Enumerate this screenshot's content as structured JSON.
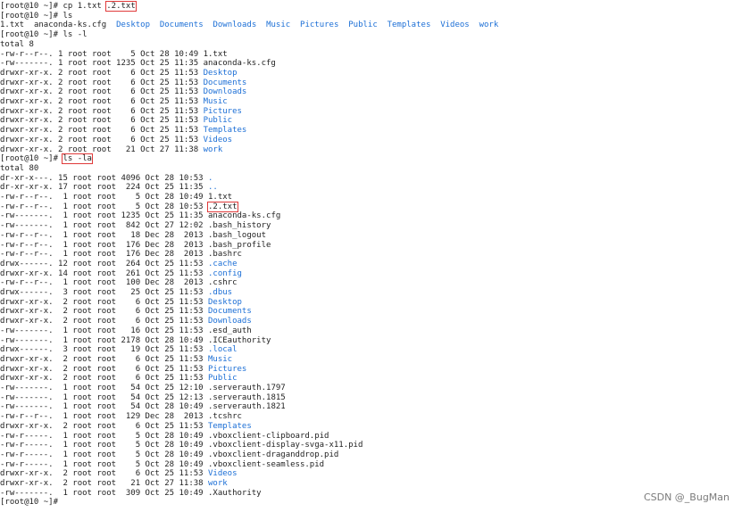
{
  "terminal": {
    "prompt": "[root@10 ~]# ",
    "lines": [
      {
        "kind": "cmd",
        "text": "cp 1.txt ",
        "hl": ".2.txt"
      },
      {
        "kind": "cmd",
        "text": "ls"
      },
      {
        "kind": "ls",
        "items": [
          {
            "t": "1.txt",
            "d": false
          },
          {
            "t": "anaconda-ks.cfg",
            "d": false
          },
          {
            "t": "Desktop",
            "d": true
          },
          {
            "t": "Documents",
            "d": true
          },
          {
            "t": "Downloads",
            "d": true
          },
          {
            "t": "Music",
            "d": true
          },
          {
            "t": "Pictures",
            "d": true
          },
          {
            "t": "Public",
            "d": true
          },
          {
            "t": "Templates",
            "d": true
          },
          {
            "t": "Videos",
            "d": true
          },
          {
            "t": "work",
            "d": true
          }
        ]
      },
      {
        "kind": "cmd",
        "text": "ls -l"
      },
      {
        "kind": "plain",
        "text": "total 8"
      },
      {
        "kind": "row",
        "p": "-rw-r--r--. 1 root root    5 Oct 28 10:49 ",
        "n": "1.txt",
        "d": false
      },
      {
        "kind": "row",
        "p": "-rw-------. 1 root root 1235 Oct 25 11:35 ",
        "n": "anaconda-ks.cfg",
        "d": false
      },
      {
        "kind": "row",
        "p": "drwxr-xr-x. 2 root root    6 Oct 25 11:53 ",
        "n": "Desktop",
        "d": true
      },
      {
        "kind": "row",
        "p": "drwxr-xr-x. 2 root root    6 Oct 25 11:53 ",
        "n": "Documents",
        "d": true
      },
      {
        "kind": "row",
        "p": "drwxr-xr-x. 2 root root    6 Oct 25 11:53 ",
        "n": "Downloads",
        "d": true
      },
      {
        "kind": "row",
        "p": "drwxr-xr-x. 2 root root    6 Oct 25 11:53 ",
        "n": "Music",
        "d": true
      },
      {
        "kind": "row",
        "p": "drwxr-xr-x. 2 root root    6 Oct 25 11:53 ",
        "n": "Pictures",
        "d": true
      },
      {
        "kind": "row",
        "p": "drwxr-xr-x. 2 root root    6 Oct 25 11:53 ",
        "n": "Public",
        "d": true
      },
      {
        "kind": "row",
        "p": "drwxr-xr-x. 2 root root    6 Oct 25 11:53 ",
        "n": "Templates",
        "d": true
      },
      {
        "kind": "row",
        "p": "drwxr-xr-x. 2 root root    6 Oct 25 11:53 ",
        "n": "Videos",
        "d": true
      },
      {
        "kind": "row",
        "p": "drwxr-xr-x. 2 root root   21 Oct 27 11:38 ",
        "n": "work",
        "d": true
      },
      {
        "kind": "cmd",
        "text": "",
        "hl": "ls -la"
      },
      {
        "kind": "plain",
        "text": "total 80"
      },
      {
        "kind": "row",
        "p": "dr-xr-x---. 15 root root 4096 Oct 28 10:53 ",
        "n": ".",
        "d": true
      },
      {
        "kind": "row",
        "p": "dr-xr-xr-x. 17 root root  224 Oct 25 11:35 ",
        "n": "..",
        "d": true
      },
      {
        "kind": "row",
        "p": "-rw-r--r--.  1 root root    5 Oct 28 10:49 ",
        "n": "1.txt",
        "d": false
      },
      {
        "kind": "row",
        "p": "-rw-r--r--.  1 root root    5 Oct 28 10:53 ",
        "n": ".2.txt",
        "d": false,
        "hl": true
      },
      {
        "kind": "row",
        "p": "-rw-------.  1 root root 1235 Oct 25 11:35 ",
        "n": "anaconda-ks.cfg",
        "d": false
      },
      {
        "kind": "row",
        "p": "-rw-------.  1 root root  842 Oct 27 12:02 ",
        "n": ".bash_history",
        "d": false
      },
      {
        "kind": "row",
        "p": "-rw-r--r--.  1 root root   18 Dec 28  2013 ",
        "n": ".bash_logout",
        "d": false
      },
      {
        "kind": "row",
        "p": "-rw-r--r--.  1 root root  176 Dec 28  2013 ",
        "n": ".bash_profile",
        "d": false
      },
      {
        "kind": "row",
        "p": "-rw-r--r--.  1 root root  176 Dec 28  2013 ",
        "n": ".bashrc",
        "d": false
      },
      {
        "kind": "row",
        "p": "drwx------. 12 root root  264 Oct 25 11:53 ",
        "n": ".cache",
        "d": true
      },
      {
        "kind": "row",
        "p": "drwxr-xr-x. 14 root root  261 Oct 25 11:53 ",
        "n": ".config",
        "d": true
      },
      {
        "kind": "row",
        "p": "-rw-r--r--.  1 root root  100 Dec 28  2013 ",
        "n": ".cshrc",
        "d": false
      },
      {
        "kind": "row",
        "p": "drwx------.  3 root root   25 Oct 25 11:53 ",
        "n": ".dbus",
        "d": true
      },
      {
        "kind": "row",
        "p": "drwxr-xr-x.  2 root root    6 Oct 25 11:53 ",
        "n": "Desktop",
        "d": true
      },
      {
        "kind": "row",
        "p": "drwxr-xr-x.  2 root root    6 Oct 25 11:53 ",
        "n": "Documents",
        "d": true
      },
      {
        "kind": "row",
        "p": "drwxr-xr-x.  2 root root    6 Oct 25 11:53 ",
        "n": "Downloads",
        "d": true
      },
      {
        "kind": "row",
        "p": "-rw-------.  1 root root   16 Oct 25 11:53 ",
        "n": ".esd_auth",
        "d": false
      },
      {
        "kind": "row",
        "p": "-rw-------.  1 root root 2178 Oct 28 10:49 ",
        "n": ".ICEauthority",
        "d": false
      },
      {
        "kind": "row",
        "p": "drwx------.  3 root root   19 Oct 25 11:53 ",
        "n": ".local",
        "d": true
      },
      {
        "kind": "row",
        "p": "drwxr-xr-x.  2 root root    6 Oct 25 11:53 ",
        "n": "Music",
        "d": true
      },
      {
        "kind": "row",
        "p": "drwxr-xr-x.  2 root root    6 Oct 25 11:53 ",
        "n": "Pictures",
        "d": true
      },
      {
        "kind": "row",
        "p": "drwxr-xr-x.  2 root root    6 Oct 25 11:53 ",
        "n": "Public",
        "d": true
      },
      {
        "kind": "row",
        "p": "-rw-------.  1 root root   54 Oct 25 12:10 ",
        "n": ".serverauth.1797",
        "d": false
      },
      {
        "kind": "row",
        "p": "-rw-------.  1 root root   54 Oct 25 12:13 ",
        "n": ".serverauth.1815",
        "d": false
      },
      {
        "kind": "row",
        "p": "-rw-------.  1 root root   54 Oct 28 10:49 ",
        "n": ".serverauth.1821",
        "d": false
      },
      {
        "kind": "row",
        "p": "-rw-r--r--.  1 root root  129 Dec 28  2013 ",
        "n": ".tcshrc",
        "d": false
      },
      {
        "kind": "row",
        "p": "drwxr-xr-x.  2 root root    6 Oct 25 11:53 ",
        "n": "Templates",
        "d": true
      },
      {
        "kind": "row",
        "p": "-rw-r-----.  1 root root    5 Oct 28 10:49 ",
        "n": ".vboxclient-clipboard.pid",
        "d": false
      },
      {
        "kind": "row",
        "p": "-rw-r-----.  1 root root    5 Oct 28 10:49 ",
        "n": ".vboxclient-display-svga-x11.pid",
        "d": false
      },
      {
        "kind": "row",
        "p": "-rw-r-----.  1 root root    5 Oct 28 10:49 ",
        "n": ".vboxclient-draganddrop.pid",
        "d": false
      },
      {
        "kind": "row",
        "p": "-rw-r-----.  1 root root    5 Oct 28 10:49 ",
        "n": ".vboxclient-seamless.pid",
        "d": false
      },
      {
        "kind": "row",
        "p": "drwxr-xr-x.  2 root root    6 Oct 25 11:53 ",
        "n": "Videos",
        "d": true
      },
      {
        "kind": "row",
        "p": "drwxr-xr-x.  2 root root   21 Oct 27 11:38 ",
        "n": "work",
        "d": true
      },
      {
        "kind": "row",
        "p": "-rw-------.  1 root root  309 Oct 25 10:49 ",
        "n": ".Xauthority",
        "d": false
      },
      {
        "kind": "cmd",
        "text": ""
      }
    ]
  },
  "watermark": "CSDN @_BugMan",
  "colors": {
    "dir": "#1c6fd6",
    "highlight_box": "#e03a3a",
    "text": "#1f1f1f"
  }
}
